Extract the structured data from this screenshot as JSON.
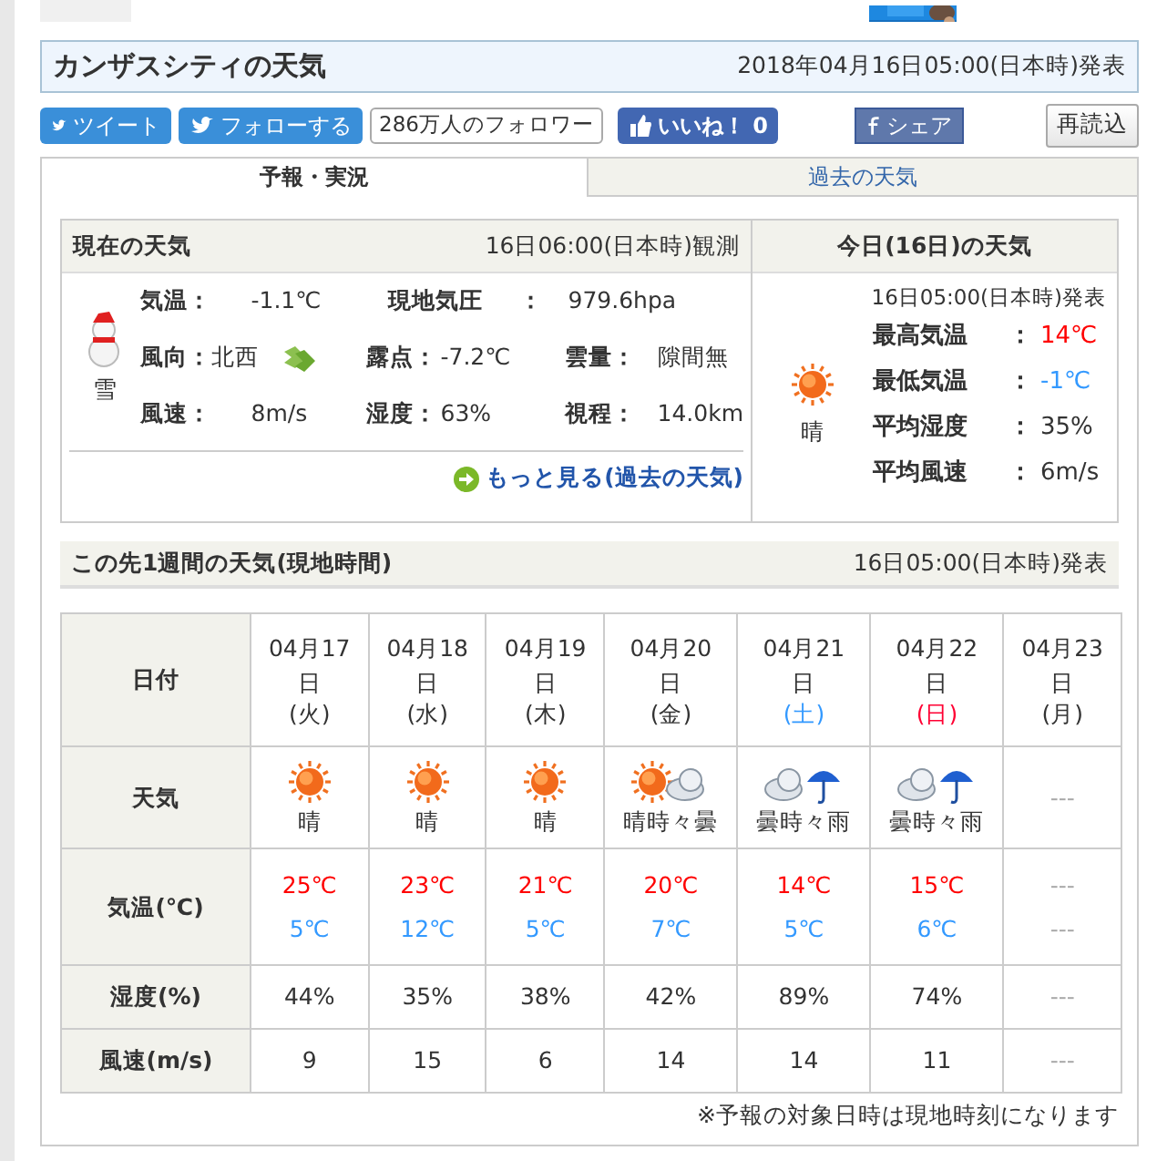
{
  "header": {
    "title": "カンザスシティの天気",
    "issued": "2018年04月16日05:00(日本時)発表"
  },
  "social": [
    {
      "kind": "tweet",
      "label": "ツイート"
    },
    {
      "kind": "follow",
      "label": "フォローする"
    },
    {
      "kind": "count",
      "label": "286万人のフォロワー"
    },
    {
      "kind": "like",
      "label": "いいね！",
      "count": "0"
    },
    {
      "kind": "share",
      "label": "シェア"
    }
  ],
  "reload": "再読込",
  "tabs": [
    {
      "label": "予報・実況",
      "selected": true
    },
    {
      "label": "過去の天気",
      "selected": false
    }
  ],
  "current": {
    "title": "現在の天気",
    "observed": "16日06:00(日本時)観測",
    "weather": {
      "kind": "snow",
      "label": "雪"
    },
    "rows": [
      [
        {
          "label": "気温：",
          "value": "-1.1℃"
        },
        {
          "label": "現地気圧",
          "sep": "：",
          "value": "979.6hpa"
        }
      ],
      [
        {
          "label": "風向：",
          "value": "北西",
          "wind_icon": true
        },
        {
          "label": "露点：",
          "value": "-7.2℃"
        },
        {
          "label": "雲量：",
          "value": "隙間無"
        }
      ],
      [
        {
          "label": "風速：",
          "value": "8m/s"
        },
        {
          "label": "湿度：",
          "value": "63%"
        },
        {
          "label": "視程：",
          "value": "14.0km"
        }
      ]
    ],
    "more_link": "もっと見る(過去の天気)"
  },
  "today": {
    "title": "今日(16日)の天気",
    "issued": "16日05:00(日本時)発表",
    "weather": {
      "kind": "sunny",
      "label": "晴"
    },
    "items": [
      {
        "label": "最高気温",
        "sep": "：",
        "value": "14℃",
        "color": "#ff0000"
      },
      {
        "label": "最低気温",
        "sep": "：",
        "value": "-1℃",
        "color": "#3399ff"
      },
      {
        "label": "平均湿度",
        "sep": "：",
        "value": "35%",
        "color": "#333333"
      },
      {
        "label": "平均風速",
        "sep": "：",
        "value": "6m/s",
        "color": "#333333"
      }
    ]
  },
  "week": {
    "title": "この先1週間の天気(現地時間)",
    "issued": "16日05:00(日本時)発表",
    "row_labels": [
      "日付",
      "天気",
      "気温(℃)",
      "湿度(%)",
      "風速(m/s)"
    ],
    "days": [
      {
        "date": "04月17日",
        "weekday": "(火)",
        "color": "#333333",
        "weather": {
          "kind": "sunny",
          "label": "晴"
        },
        "high": "25℃",
        "low": "5℃",
        "humidity": "44%",
        "wind": "9"
      },
      {
        "date": "04月18日",
        "weekday": "(水)",
        "color": "#333333",
        "weather": {
          "kind": "sunny",
          "label": "晴"
        },
        "high": "23℃",
        "low": "12℃",
        "humidity": "35%",
        "wind": "15"
      },
      {
        "date": "04月19日",
        "weekday": "(木)",
        "color": "#333333",
        "weather": {
          "kind": "sunny",
          "label": "晴"
        },
        "high": "21℃",
        "low": "5℃",
        "humidity": "38%",
        "wind": "6"
      },
      {
        "date": "04月20日",
        "weekday": "(金)",
        "color": "#333333",
        "weather": {
          "kind": "sunny_cloudy",
          "label": "晴時々曇"
        },
        "high": "20℃",
        "low": "7℃",
        "humidity": "42%",
        "wind": "14"
      },
      {
        "date": "04月21日",
        "weekday": "(土)",
        "color": "#3399ff",
        "weather": {
          "kind": "cloudy_rain",
          "label": "曇時々雨"
        },
        "high": "14℃",
        "low": "5℃",
        "humidity": "89%",
        "wind": "14"
      },
      {
        "date": "04月22日",
        "weekday": "(日)",
        "color": "#ff0033",
        "weather": {
          "kind": "cloudy_rain",
          "label": "曇時々雨"
        },
        "high": "15℃",
        "low": "6℃",
        "humidity": "74%",
        "wind": "11"
      },
      {
        "date": "04月23日",
        "weekday": "(月)",
        "color": "#333333",
        "weather": {
          "kind": "none",
          "label": "---"
        },
        "high": "---",
        "low": "---",
        "humidity": "---",
        "wind": "---"
      }
    ],
    "note": "※予報の対象日時は現地時刻になります"
  }
}
